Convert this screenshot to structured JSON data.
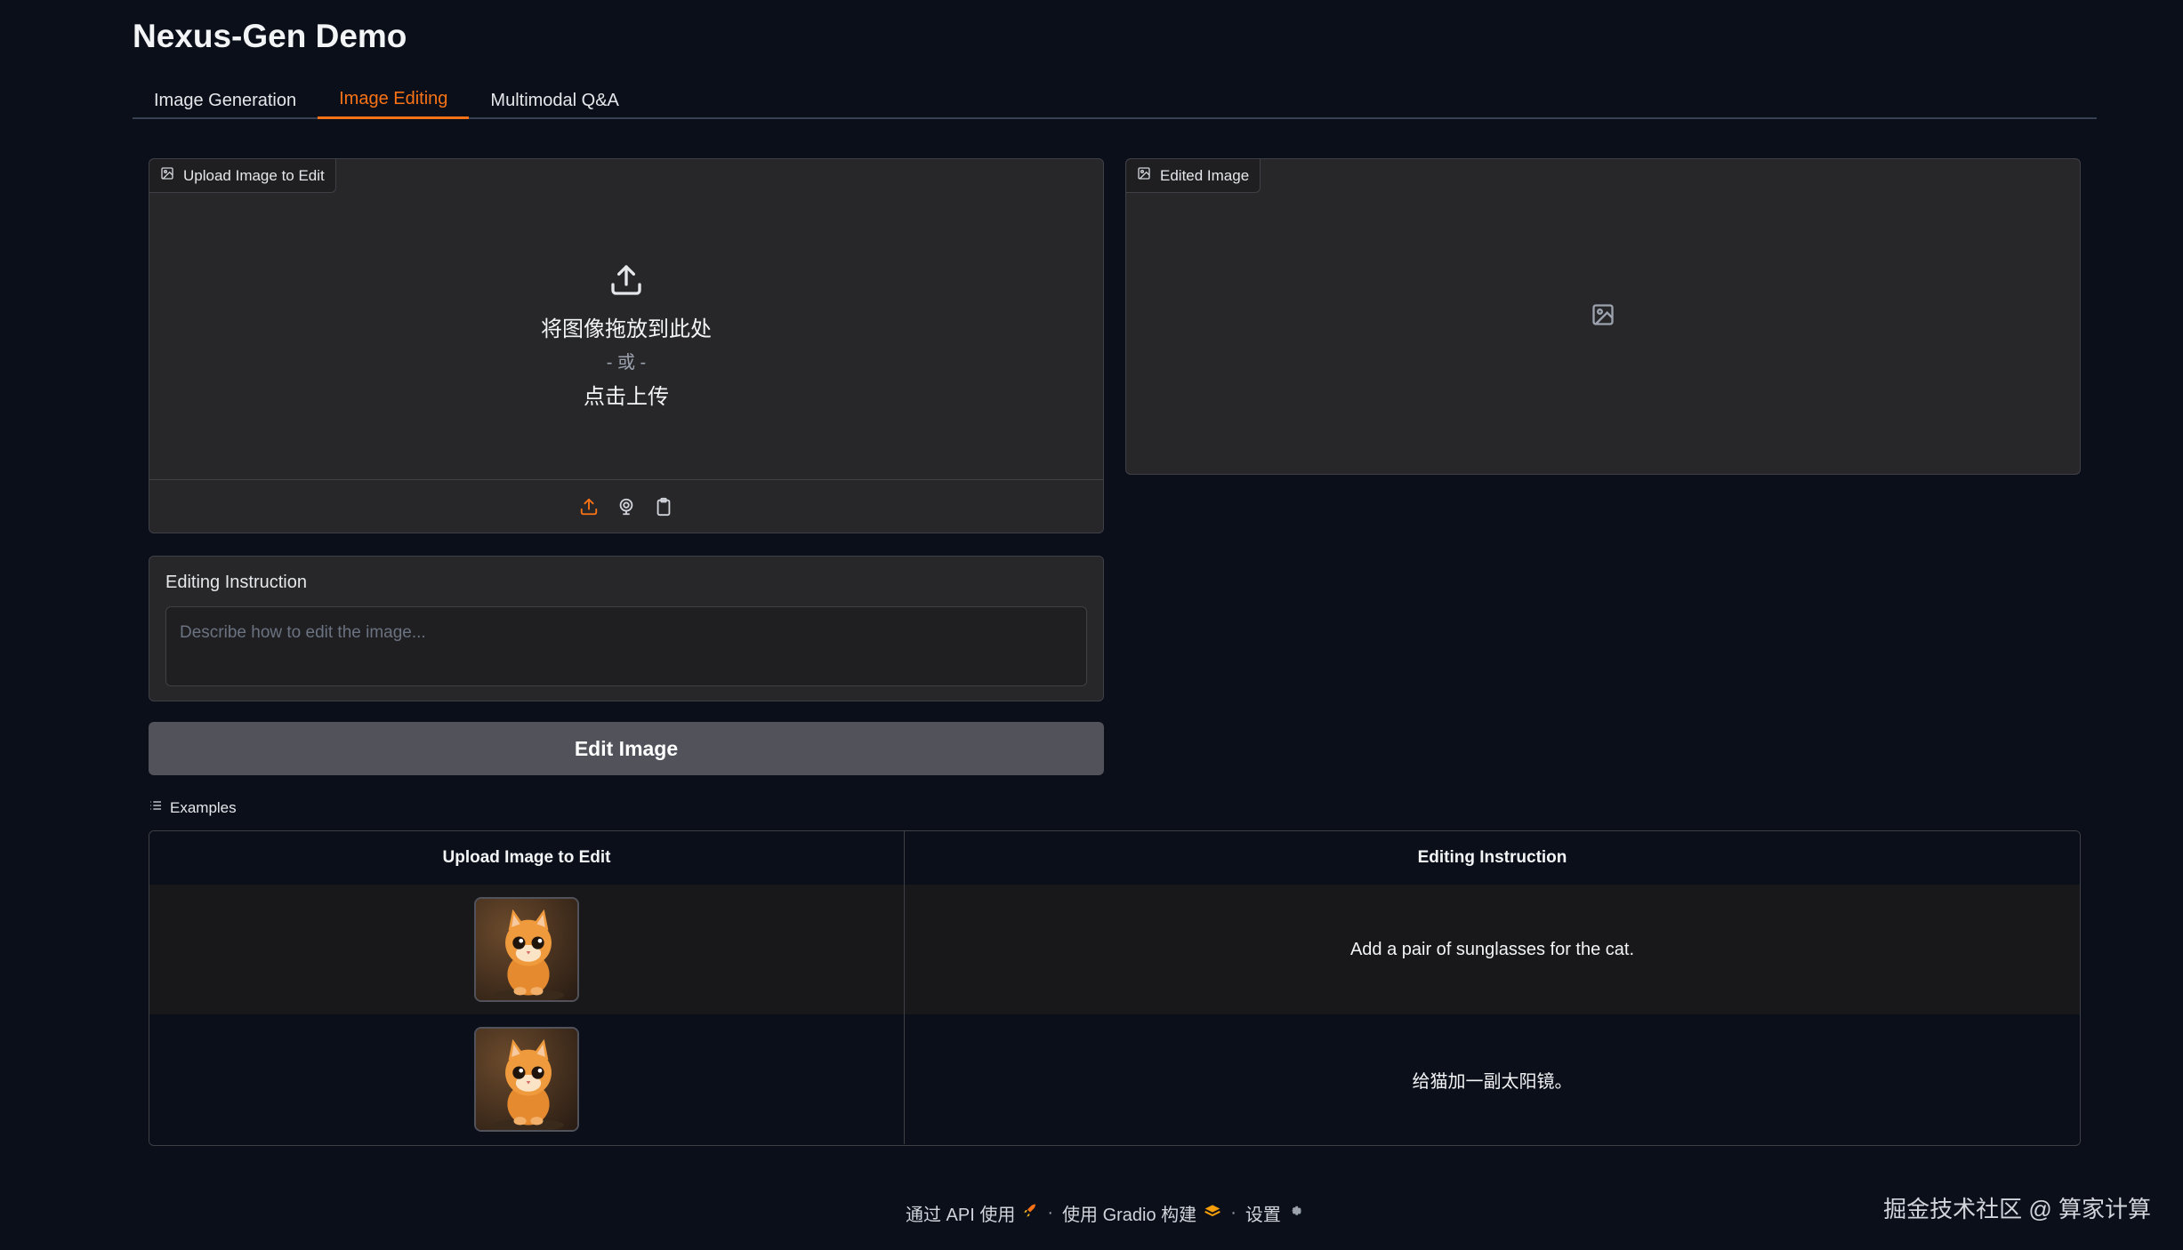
{
  "app": {
    "title": "Nexus-Gen Demo"
  },
  "tabs": [
    {
      "label": "Image Generation",
      "active": false
    },
    {
      "label": "Image Editing",
      "active": true
    },
    {
      "label": "Multimodal Q&A",
      "active": false
    }
  ],
  "upload": {
    "label": "Upload Image to Edit",
    "drop_text": "将图像拖放到此处",
    "or_text": "- 或 -",
    "click_text": "点击上传",
    "toolbar_icons": [
      "upload-icon",
      "webcam-icon",
      "clipboard-icon"
    ]
  },
  "edited": {
    "label": "Edited Image",
    "empty_icon": "image-icon"
  },
  "instruction": {
    "label": "Editing Instruction",
    "placeholder": "Describe how to edit the image...",
    "value": ""
  },
  "edit_button": {
    "label": "Edit Image"
  },
  "examples": {
    "label": "Examples",
    "headers": [
      "Upload Image to Edit",
      "Editing Instruction"
    ],
    "rows": [
      {
        "image": "cat-thumbnail",
        "instruction": "Add a pair of sunglasses for the cat."
      },
      {
        "image": "cat-thumbnail",
        "instruction": "给猫加一副太阳镜。"
      }
    ]
  },
  "footer": {
    "api": "通过 API 使用",
    "sep": "·",
    "built": "使用 Gradio 构建",
    "settings": "设置"
  },
  "watermark": "掘金技术社区 @ 算家计算",
  "colors": {
    "accent": "#f97316",
    "background": "#0b0f19",
    "panel": "#27272a"
  }
}
